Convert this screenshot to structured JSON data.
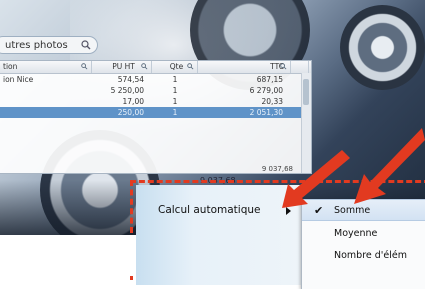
{
  "search": {
    "placeholder": "utres photos"
  },
  "table": {
    "headers": [
      "tion",
      "PU HT",
      "Qte",
      "TTC"
    ],
    "rows": [
      {
        "description": "ion Nice",
        "pu_ht": "574,54",
        "qte": "1",
        "ttc": "687,15"
      },
      {
        "description": "",
        "pu_ht": "5 250,00",
        "qte": "1",
        "ttc": "6 279,00"
      },
      {
        "description": "",
        "pu_ht": "17,00",
        "qte": "1",
        "ttc": "20,33"
      },
      {
        "description": "",
        "pu_ht": "250,00",
        "qte": "1",
        "ttc": "2 051,30"
      }
    ],
    "total": "9 037,68",
    "total_preview": "9 037,68"
  },
  "menu": {
    "item": "Calcul automatique",
    "submenu": [
      "Somme",
      "Moyenne",
      "Nombre d'élém"
    ]
  },
  "colors": {
    "accent_red": "#e23a20",
    "selection": "#5f93c8"
  }
}
